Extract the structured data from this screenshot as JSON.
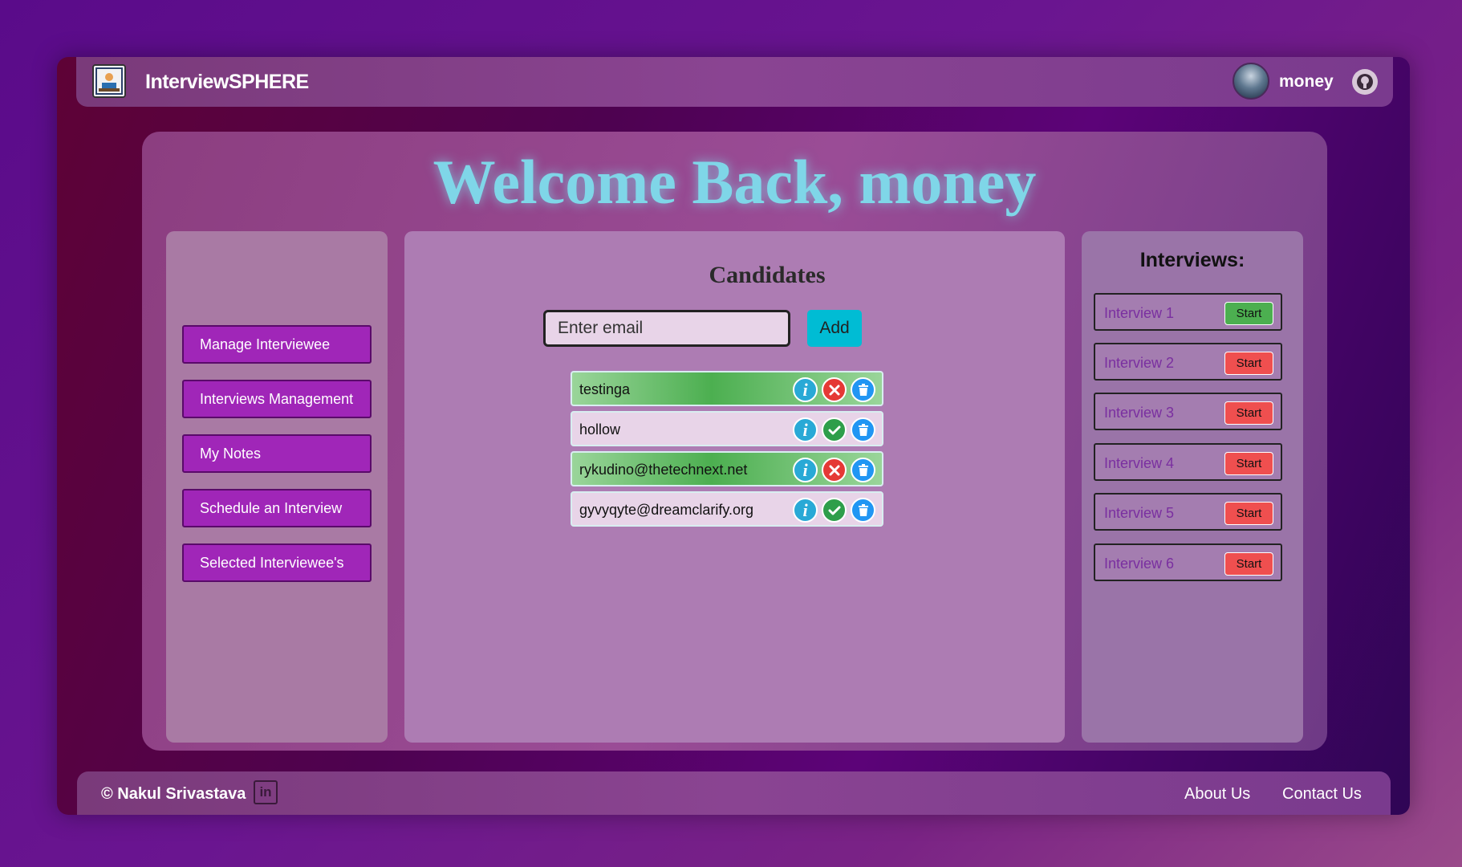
{
  "header": {
    "brand": "InterviewSPHERE",
    "username": "money"
  },
  "welcome": "Welcome Back, money",
  "sidebar": {
    "items": [
      {
        "label": "Manage Interviewee"
      },
      {
        "label": "Interviews Management"
      },
      {
        "label": "My Notes"
      },
      {
        "label": "Schedule an Interview"
      },
      {
        "label": "Selected Interviewee's"
      }
    ]
  },
  "candidates": {
    "title": "Candidates",
    "input_placeholder": "Enter email",
    "add_label": "Add",
    "list": [
      {
        "name": "testinga",
        "status": "rejected"
      },
      {
        "name": "hollow",
        "status": "accepted"
      },
      {
        "name": "rykudino@thetechnext.net",
        "status": "rejected"
      },
      {
        "name": "gyvyqyte@dreamclarify.org",
        "status": "accepted"
      }
    ]
  },
  "interviews": {
    "title": "Interviews:",
    "items": [
      {
        "name": "Interview 1",
        "button": "Start",
        "color": "#4caf50"
      },
      {
        "name": "Interview 2",
        "button": "Start",
        "color": "#ef4f4f"
      },
      {
        "name": "Interview 3",
        "button": "Start",
        "color": "#ef4f4f"
      },
      {
        "name": "Interview 4",
        "button": "Start",
        "color": "#ef4f4f"
      },
      {
        "name": "Interview 5",
        "button": "Start",
        "color": "#ef4f4f"
      },
      {
        "name": "Interview 6",
        "button": "Start",
        "color": "#ef4f4f"
      }
    ]
  },
  "footer": {
    "copyright": "© Nakul Srivastava",
    "linkedin_text": "in",
    "links": [
      "About Us",
      "Contact Us"
    ]
  },
  "colors": {
    "accent": "#00bcd4",
    "sidebar_button": "#a026b8",
    "welcome_text": "#7fd6e8"
  }
}
